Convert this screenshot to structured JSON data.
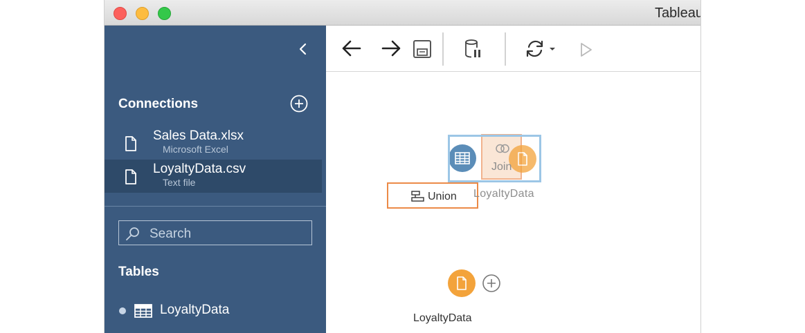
{
  "window": {
    "title": "Tableau"
  },
  "sidebar": {
    "collapse_icon": "chevron-left-icon",
    "connections_heading": "Connections",
    "connections": [
      {
        "name": "Sales Data.xlsx",
        "type": "Microsoft Excel",
        "icon": "document-icon",
        "selected": false
      },
      {
        "name": "LoyaltyData.csv",
        "type": "Text file",
        "icon": "document-icon",
        "selected": true
      }
    ],
    "search_placeholder": "Search",
    "tables_heading": "Tables",
    "tables": [
      {
        "name": "LoyaltyData",
        "icon": "table-grid-icon"
      }
    ]
  },
  "toolbar": {
    "buttons": [
      "back-arrow-icon",
      "forward-arrow-icon",
      "save-icon",
      "data-pause-icon",
      "refresh-icon",
      "run-icon"
    ]
  },
  "canvas": {
    "union_label": "Union",
    "join_label": "Join",
    "ghost_node_label": "LoyaltyData",
    "input_node_label": "LoyaltyData"
  },
  "colors": {
    "sidebar": "#3b5a7f",
    "sidebar_selected": "#2e4a69",
    "orange": "#f3a33b",
    "blue_node": "#5b8db8",
    "union_border": "#ec8a47",
    "join_highlight": "#9cc6e6"
  }
}
